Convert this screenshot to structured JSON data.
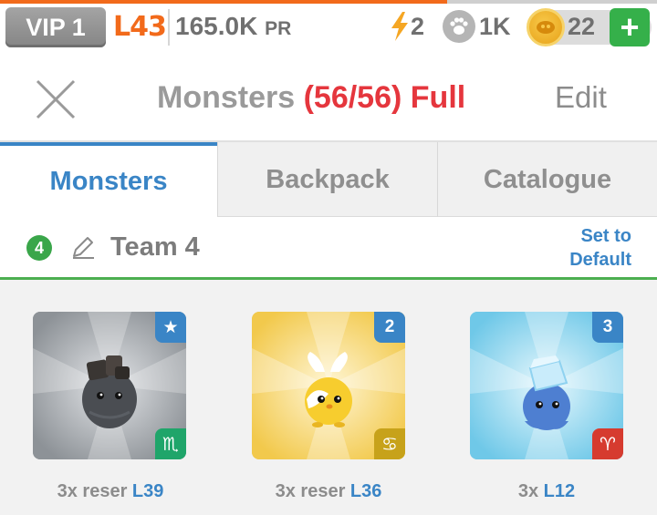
{
  "status": {
    "vip": "VIP 1",
    "level": "L43",
    "power": "165.0K",
    "power_unit": "PR",
    "energy": "2",
    "paw": "1K",
    "coins": "22",
    "add": "+"
  },
  "header": {
    "title": "Monsters",
    "count": "(56/56)",
    "full": "Full",
    "edit": "Edit"
  },
  "tabs": [
    {
      "label": "Monsters",
      "active": true
    },
    {
      "label": "Backpack",
      "active": false
    },
    {
      "label": "Catalogue",
      "active": false
    }
  ],
  "team": {
    "number": "4",
    "name": "Team 4",
    "set_default_line1": "Set to",
    "set_default_line2": "Default"
  },
  "monsters": [
    {
      "prefix": "3x reser ",
      "level": "L39",
      "tag": "★",
      "sign": "♏",
      "sign_color": "#1fa56a",
      "tag_color": "#3a85c6",
      "bg": "#9aa0a6"
    },
    {
      "prefix": "3x reser ",
      "level": "L36",
      "tag": "2",
      "sign": "♋",
      "sign_color": "#c7a21a",
      "tag_color": "#3a85c6",
      "bg": "#f4d35e"
    },
    {
      "prefix": "3x ",
      "level": "L12",
      "tag": "3",
      "sign": "♈",
      "sign_color": "#d63b2f",
      "tag_color": "#3a85c6",
      "bg": "#7fd3ee"
    }
  ],
  "colors": {
    "accent_blue": "#3a85c6",
    "full_red": "#e5363d",
    "level_orange": "#f26a1b",
    "team_green": "#4caf50"
  }
}
